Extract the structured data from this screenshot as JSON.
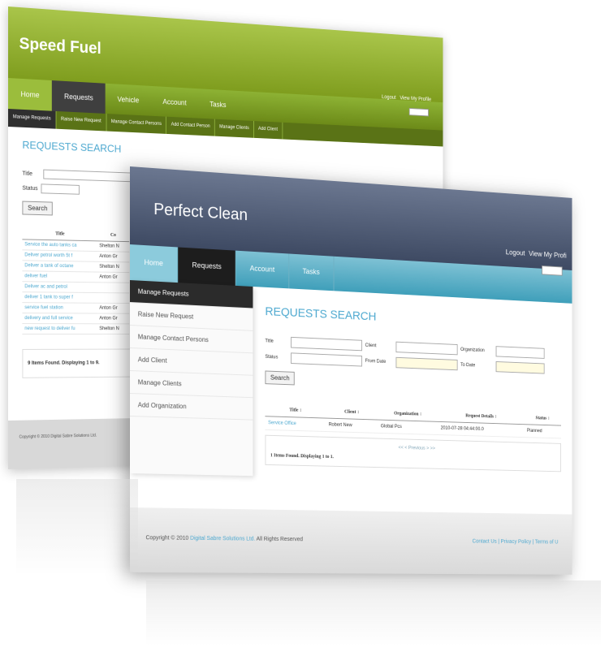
{
  "back_app": {
    "brand": "Speed Fuel",
    "toplinks": [
      "Logout",
      "View My Profile"
    ],
    "nav": [
      "Home",
      "Requests",
      "Vehicle",
      "Account",
      "Tasks"
    ],
    "subnav": [
      "Manage Requests",
      "Raise New Request",
      "Manage Contact Persons",
      "Add Contact Person",
      "Manage Clients",
      "Add Client"
    ],
    "title": "REQUESTS SEARCH",
    "labels": {
      "title": "Title",
      "status": "Status"
    },
    "search_label": "Search",
    "table": {
      "headers": [
        "Title",
        "Co"
      ],
      "rows": [
        [
          "Service the auto tanks ca",
          "Shelton N"
        ],
        [
          "Deliver petrol worth 5t f",
          "Anton Gr"
        ],
        [
          "Deliver a tank of octane",
          "Shelton N"
        ],
        [
          "deliver fuel",
          "Anton Gr"
        ],
        [
          "Deliver ac and petrol",
          ""
        ],
        [
          "deliver 1 tank to super f",
          ""
        ],
        [
          "service fuel station",
          "Anton Gr"
        ],
        [
          "delivery and full service",
          "Anton Gr"
        ],
        [
          "new request to deliver fu",
          "Shelton N"
        ]
      ]
    },
    "found": "9 Items Found. Displaying 1 to 9.",
    "footer": "Copyright © 2010 Digital Sabre Solutions Ltd."
  },
  "front_app": {
    "brand": "Perfect Clean",
    "toplinks": [
      "Logout",
      "View My Profi"
    ],
    "nav": [
      "Home",
      "Requests",
      "Account",
      "Tasks"
    ],
    "side": [
      "Manage Requests",
      "Raise New Request",
      "Manage Contact Persons",
      "Add Client",
      "Manage Clients",
      "Add Organization"
    ],
    "title": "REQUESTS SEARCH",
    "labels": {
      "title": "Title",
      "client": "Client",
      "organization": "Organization",
      "status": "Status",
      "from_date": "From Date",
      "to_date": "To Date"
    },
    "search_label": "Search",
    "table": {
      "headers": [
        "Title ↕",
        "Client ↕",
        "Organization ↕",
        "Request Details ↕",
        "Status ↕"
      ],
      "rows": [
        [
          "Service Office",
          "Robert New",
          "Global Pcs",
          "2010-07-28 04:44:00.0",
          "Planned"
        ]
      ]
    },
    "pager": "<< < Previous > >>",
    "found": "1 Items Found. Displaying 1 to 1.",
    "footer": {
      "copyright_prefix": "Copyright © 2010",
      "company": "Digital Sabre Solutions Ltd.",
      "copyright_suffix": "All Rights Reserved",
      "links": "Contact Us | Privacy Policy | Terms of U"
    }
  }
}
